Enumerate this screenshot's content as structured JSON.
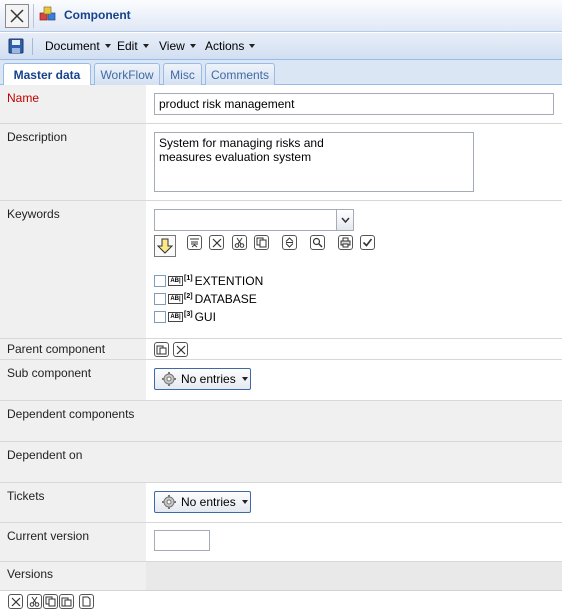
{
  "window": {
    "title": "Component"
  },
  "icons": {
    "close": "close-x-icon",
    "component": "component-cubes-icon",
    "save": "floppy-disk-icon",
    "settings": "gear-icon"
  },
  "menu": {
    "items": [
      "Document",
      "Edit",
      "View",
      "Actions"
    ]
  },
  "tabs": [
    {
      "label": "Master data",
      "active": true
    },
    {
      "label": "WorkFlow",
      "active": false
    },
    {
      "label": "Misc",
      "active": false
    },
    {
      "label": "Comments",
      "active": false
    }
  ],
  "form": {
    "name": {
      "label": "Name",
      "value": "product risk management"
    },
    "description": {
      "label": "Description",
      "value": "System for managing risks and\nmeasures evaluation system"
    },
    "keywords": {
      "label": "Keywords",
      "combo_value": "",
      "items": [
        {
          "num": "[1]",
          "text": "EXTENTION"
        },
        {
          "num": "[2]",
          "text": "DATABASE"
        },
        {
          "num": "[3]",
          "text": "GUI"
        }
      ]
    },
    "parent_component": {
      "label": "Parent component"
    },
    "sub_component": {
      "label": "Sub component",
      "button": "No entries"
    },
    "dependent_components": {
      "label": "Dependent components"
    },
    "dependent_on": {
      "label": "Dependent on"
    },
    "tickets": {
      "label": "Tickets",
      "button": "No entries"
    },
    "current_version": {
      "label": "Current version",
      "value": ""
    },
    "versions": {
      "label": "Versions"
    }
  },
  "colors": {
    "title_text": "#15428b",
    "required_label": "#c00000",
    "label_bg": "#f0f0f0",
    "tab_border": "#99bbe8"
  }
}
